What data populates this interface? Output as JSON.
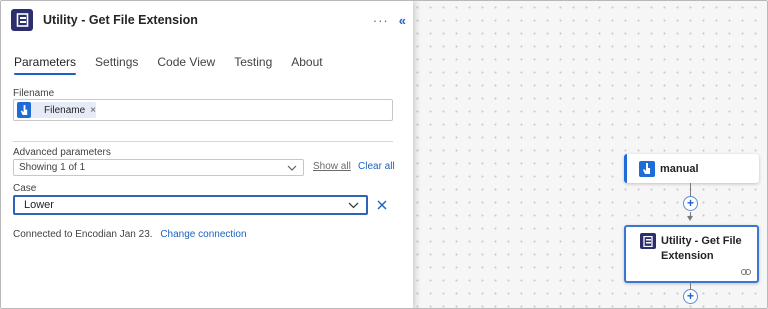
{
  "panel": {
    "title": "Utility - Get File Extension",
    "more_label": "···",
    "collapse_label": "«",
    "tabs": [
      {
        "label": "Parameters",
        "active": true
      },
      {
        "label": "Settings",
        "active": false
      },
      {
        "label": "Code View",
        "active": false
      },
      {
        "label": "Testing",
        "active": false
      },
      {
        "label": "About",
        "active": false
      }
    ],
    "filename": {
      "label": "Filename",
      "token_text": "Filename",
      "token_remove": "×"
    },
    "advanced": {
      "label": "Advanced parameters",
      "selected": "Showing 1 of 1",
      "show_all": "Show all",
      "clear_all": "Clear all"
    },
    "case": {
      "label": "Case",
      "value": "Lower"
    },
    "connection": {
      "text": "Connected to Encodian Jan 23.",
      "change_link": "Change connection"
    }
  },
  "canvas": {
    "nodes": [
      {
        "label": "manual",
        "icon": "manual-trigger-icon"
      },
      {
        "label": "Utility - Get File Extension",
        "icon": "encodian-icon"
      }
    ],
    "add_step_symbol": "+"
  },
  "colors": {
    "accent": "#1d61c3",
    "encodian": "#2c2d6d",
    "trigger": "#1f6cd6"
  }
}
